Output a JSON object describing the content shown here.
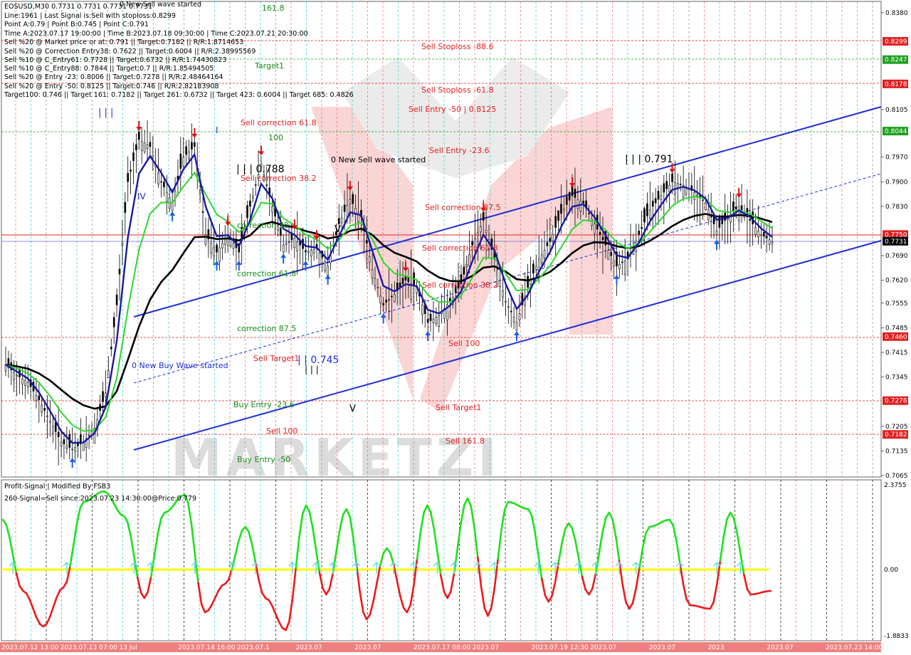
{
  "header": {
    "lines": [
      "EOSUSD,M30  0.7731 0.7731 0.7731 0.7731",
      "Line:1961 | Last Signal is:Sell with stoploss:0.8299",
      "Point A:0.79 | Point B:0.745 | Point C:0.791",
      "Time A:2023.07.17 19:00:00 | Time B:2023.07.18 09:30:00 | Time C:2023.07.21 20:30:00",
      "Sell %20 @ Market price or at: 0.791 || Target:0.7182 || R/R:1.8714653",
      "Sell %20 @ Correction Entry38: 0.7622 || Target:0.6004 || R/R:2.38995569",
      "Sell %10 @ C_Entry61: 0.7728 || Target:0.6732 || R/R:1.74430823",
      "Sell %10 @ C_Entry88: 0.7844 || Target:0.7 || R/R:1.85494505",
      "Sell %20 @ Entry -23: 0.8006 || Target:0.7278 || R/R:2.48464164",
      "Sell %20 @ Entry -50: 0.8125 || Target:0.746 || R/R:2.82183908",
      "Target100: 0.746 || Target 161: 0.7182 || Target 261: 0.6732 || Target 423: 0.6004 || Target 685: 0.4826"
    ],
    "wave_title": "0 New Sell wave started"
  },
  "levels_text": {
    "target_1618": "161.8",
    "target1": "Target1",
    "sell_stoploss_886": "Sell Stoploss -88.6",
    "sell_stoploss_618": "Sell Stoploss -61.8",
    "sell_entry_50": "Sell Entry -50 | 0.8125",
    "sell_entry_236": "Sell Entry -23.6",
    "sell_correction_618": "Sell correction 61.8",
    "hundred": "100",
    "sell_correction_382": "Sell correction 38.2",
    "sell_correction_875": "Sell correction 87.5",
    "sell_correction_618b": "Sell correction 61.8",
    "sell_correction_382b": "Sell correction 38.2",
    "correction_382": "correction 38",
    "correction_618": "correction 61.8",
    "correction_875": "correction 87.5",
    "sell_100": "Sell 100",
    "sell_target1": "Sell Target1",
    "sell_target1b": "Sell Target1",
    "buy_entry_236": "Buy Entry -23.6",
    "sell_100b": "Sell 100",
    "sell_1618": "Sell 161.8",
    "buy_entry_50": "Buy Entry -50",
    "new_sell_wave": "0 New Sell wave started",
    "new_buy_wave": "0 New Buy Wave started",
    "wave_0788": "| | | 0.788",
    "wave_0791": "| | | 0.791",
    "wave_0745": "| | 0.745",
    "wave_iii": "| | |",
    "wave_iiib": "| | |",
    "wave_v": "V",
    "wave_v2": "V",
    "wave_one": "I",
    "wave_iv": "IV"
  },
  "price_tags": [
    {
      "value": "0.8299",
      "color": "#e02020"
    },
    {
      "value": "0.8247",
      "color": "#20a020"
    },
    {
      "value": "0.8178",
      "color": "#e02020"
    },
    {
      "value": "0.8044",
      "color": "#20a020"
    },
    {
      "value": "0.7750",
      "color": "#e02020"
    },
    {
      "value": "0.7731",
      "color": "#000000"
    },
    {
      "value": "0.7460",
      "color": "#e02020"
    },
    {
      "value": "0.7278",
      "color": "#e02020"
    },
    {
      "value": "0.7182",
      "color": "#e02020"
    }
  ],
  "y_axis_ticks": [
    "0.8380",
    "0.8105",
    "0.7970",
    "0.7900",
    "0.7830",
    "0.7690",
    "0.7620",
    "0.7555",
    "0.7485",
    "0.7415",
    "0.7345",
    "0.7205",
    "0.7135",
    "0.7065"
  ],
  "x_axis_ticks": [
    "2023.07.12 13:00",
    "2023.07.13 07:00",
    "13 Jul",
    "2023.07.14 16:00",
    "2023.07.1",
    "2023.07",
    "2023.07",
    "2023.07.17 08:00",
    "2023.07",
    "2023.07.19 12:30",
    "2023.07",
    "2023.07",
    "2023",
    "2023.07",
    "2023.07.23 14:00"
  ],
  "oscillator": {
    "title": "Profit-Signal | Modified By FSB3",
    "signal": "260-Signal=Sell since:2023.07.23 14:30:00@Price:0.779",
    "ticks": [
      "2.3755",
      "0.00",
      "-1.8833"
    ]
  },
  "watermark": "MARKETZI",
  "colors": {
    "channel": "#1f2fd6",
    "ema_black": "#000000",
    "ema_green": "#2cd82c",
    "ema_blue": "#1a1aa0",
    "buy_arrow": "#1a60e0",
    "sell_arrow": "#e01010",
    "osc_pos": "#1ee01e",
    "osc_neg": "#ee1a1a",
    "zero_line": "#ffff00",
    "level_red": "#e02020",
    "level_green": "#1a8a1a"
  },
  "chart_data": {
    "type": "line",
    "title": "EOSUSD,M30",
    "ylim": [
      0.7065,
      0.838
    ],
    "series": [
      {
        "name": "EOSUSD",
        "values": [
          0.738,
          0.735,
          0.733,
          0.728,
          0.722,
          0.716,
          0.714,
          0.716,
          0.72,
          0.73,
          0.755,
          0.79,
          0.802,
          0.8,
          0.79,
          0.784,
          0.797,
          0.8,
          0.775,
          0.77,
          0.775,
          0.77,
          0.783,
          0.795,
          0.783,
          0.772,
          0.774,
          0.77,
          0.771,
          0.766,
          0.778,
          0.785,
          0.78,
          0.765,
          0.755,
          0.758,
          0.762,
          0.76,
          0.75,
          0.752,
          0.756,
          0.761,
          0.772,
          0.779,
          0.768,
          0.756,
          0.75,
          0.76,
          0.768,
          0.773,
          0.781,
          0.786,
          0.784,
          0.778,
          0.772,
          0.766,
          0.768,
          0.775,
          0.782,
          0.786,
          0.79,
          0.789,
          0.787,
          0.784,
          0.776,
          0.78,
          0.783,
          0.779,
          0.775,
          0.773
        ]
      },
      {
        "name": "Profit-Signal",
        "values": [
          1.4,
          -0.6,
          -1.6,
          -0.5,
          1.9,
          2.2,
          1.5,
          -0.8,
          1.6,
          2.1,
          -1.2,
          -0.4,
          1.2,
          -0.8,
          -1.7,
          1.8,
          -0.7,
          1.7,
          -1.4,
          0.6,
          -1.2,
          1.8,
          -0.8,
          2.0,
          -1.3,
          1.9,
          1.7,
          -0.9,
          1.3,
          -0.7,
          1.6,
          -1.1,
          1.2,
          1.4,
          -1.0,
          -1.1,
          1.6,
          -0.7,
          -0.6
        ]
      }
    ]
  }
}
